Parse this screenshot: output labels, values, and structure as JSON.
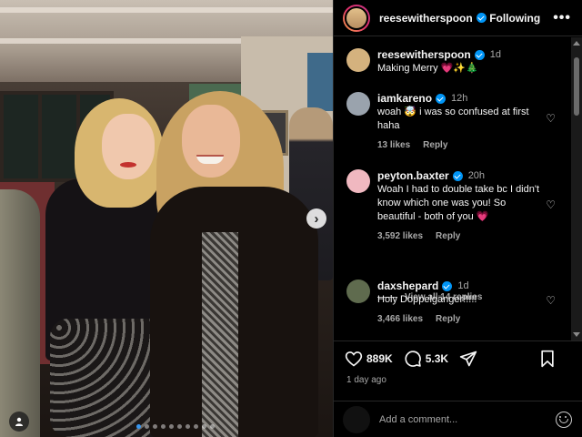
{
  "post": {
    "username": "reesewitherspoon",
    "follow_label": "Following",
    "more_label": "•••",
    "next_label": "›",
    "carousel": {
      "total": 10,
      "active_index": 0
    }
  },
  "comments": [
    {
      "username": "reesewitherspoon",
      "time": "1d",
      "text": "Making Merry 💗✨🎄",
      "likes": "",
      "reply": "",
      "avatar_color": "#d4b27e"
    },
    {
      "username": "iamkareno",
      "time": "12h",
      "text": "woah 🤯 i was so confused at first haha",
      "likes": "13 likes",
      "reply": "Reply",
      "avatar_color": "#9aa3ad"
    },
    {
      "username": "peyton.baxter",
      "time": "20h",
      "text": "Woah I had to double take bc I didn't know which one was you! So beautiful - both of you 💗",
      "likes": "3,592 likes",
      "reply": "Reply",
      "avatar_color": "#f0b8c0"
    },
    {
      "username": "daxshepard",
      "time": "1d",
      "text": "Holy Doppelgänger!!!!!",
      "likes": "3,466 likes",
      "reply": "Reply",
      "avatar_color": "#5f6b4e"
    }
  ],
  "view_replies": "View all 14 replies",
  "actions": {
    "likes": "889K",
    "comments": "5.3K"
  },
  "time_ago": "1 day ago",
  "add_comment": {
    "placeholder": "Add a comment..."
  },
  "colors": {
    "verified": "#0095f6",
    "accent_heart": "#e1306c"
  }
}
